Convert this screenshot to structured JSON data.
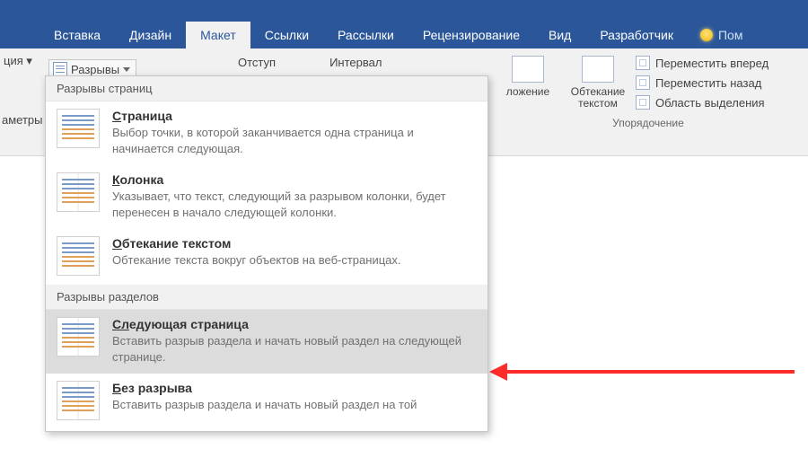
{
  "tabs": {
    "insert": "Вставка",
    "design": "Дизайн",
    "layout": "Макет",
    "references": "Ссылки",
    "mailings": "Рассылки",
    "review": "Рецензирование",
    "view": "Вид",
    "developer": "Разработчик",
    "tell_me": "Пом"
  },
  "ribbon": {
    "left_chunk": "ция ▾",
    "breaks_btn": "Разрывы",
    "indent_label": "Отступ",
    "spacing_label": "Интервал",
    "params_label": "аметры"
  },
  "arrange": {
    "position_label": "ложение",
    "wrap_label": "Обтекание текстом",
    "bring_forward": "Переместить вперед",
    "send_backward": "Переместить назад",
    "selection_pane": "Область выделения",
    "group_caption": "Упорядочение"
  },
  "menu": {
    "page_header": "Разрывы страниц",
    "section_header": "Разрывы разделов",
    "items": {
      "page": {
        "title_u": "С",
        "title_rest": "траница",
        "desc": "Выбор точки, в которой заканчивается одна страница и начинается следующая."
      },
      "column": {
        "title_u": "К",
        "title_rest": "олонка",
        "desc": "Указывает, что текст, следующий за разрывом колонки, будет перенесен в начало следующей колонки."
      },
      "textwrap": {
        "title_u": "О",
        "title_rest": "бтекание текстом",
        "desc": "Обтекание текста вокруг объектов на веб-страницах."
      },
      "nextpage": {
        "title_u": "Сл",
        "title_rest": "едующая страница",
        "desc": "Вставить разрыв раздела и начать новый раздел на следующей странице."
      },
      "continuous": {
        "title_u": "Б",
        "title_rest": "ез разрыва",
        "desc": "Вставить разрыв раздела и начать новый раздел на той"
      }
    }
  }
}
